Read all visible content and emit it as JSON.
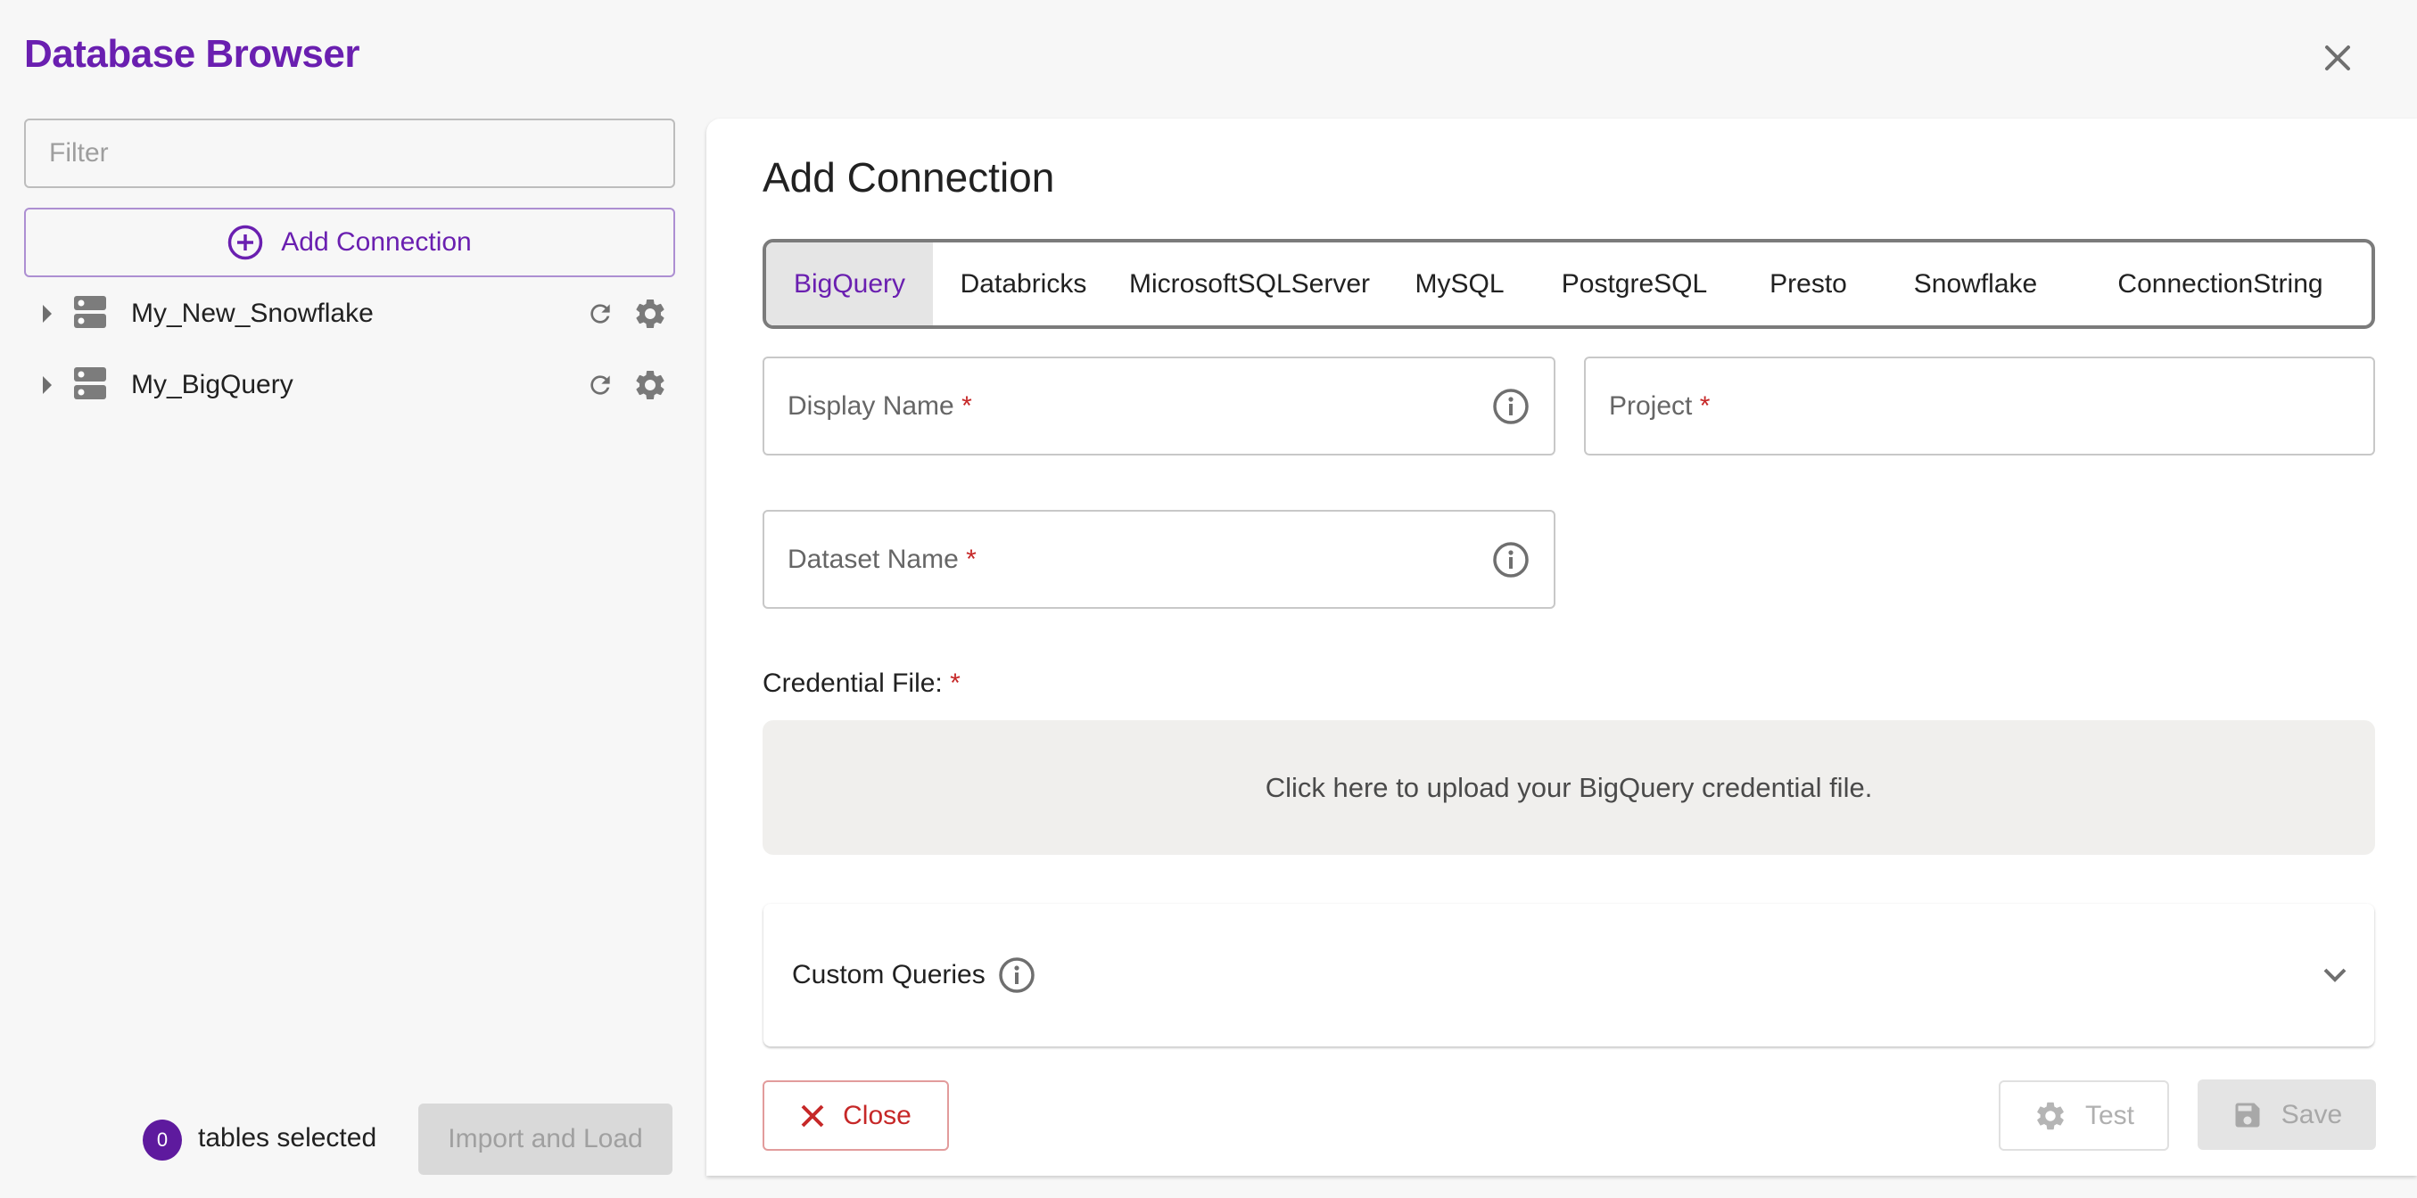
{
  "app": {
    "title": "Database Browser",
    "close_label": "Close window"
  },
  "sidebar": {
    "filter": {
      "placeholder": "Filter",
      "value": ""
    },
    "add_connection_label": "Add Connection",
    "connections": [
      {
        "name": "My_New_Snowflake",
        "expand_icon": "caret-right-icon",
        "type_icon": "database-server-icon"
      },
      {
        "name": "My_BigQuery",
        "expand_icon": "caret-right-icon",
        "type_icon": "database-server-icon"
      }
    ],
    "footer": {
      "selected_count": "0",
      "selected_label": "tables selected",
      "import_button": "Import and Load",
      "import_enabled": false
    }
  },
  "main": {
    "title": "Add Connection",
    "tabs": [
      {
        "label": "BigQuery",
        "active": true
      },
      {
        "label": "Databricks",
        "active": false
      },
      {
        "label": "MicrosoftSQLServer",
        "active": false
      },
      {
        "label": "MySQL",
        "active": false
      },
      {
        "label": "PostgreSQL",
        "active": false
      },
      {
        "label": "Presto",
        "active": false
      },
      {
        "label": "Snowflake",
        "active": false
      },
      {
        "label": "ConnectionString",
        "active": false
      }
    ],
    "fields": {
      "display_name": {
        "label": "Display Name",
        "required": "*",
        "value": ""
      },
      "project": {
        "label": "Project",
        "required": "*",
        "value": ""
      },
      "dataset_name": {
        "label": "Dataset Name",
        "required": "*",
        "value": ""
      }
    },
    "credential": {
      "label": "Credential File:",
      "required": "*",
      "upload_text": "Click here to upload your BigQuery credential file."
    },
    "custom_queries": {
      "label": "Custom Queries",
      "expanded": false
    },
    "actions": {
      "close": "Close",
      "test": "Test",
      "save": "Save",
      "test_enabled": false,
      "save_enabled": false
    }
  },
  "colors": {
    "accent": "#6a1fb0",
    "danger": "#c62828",
    "badge": "#5e1a9e"
  }
}
